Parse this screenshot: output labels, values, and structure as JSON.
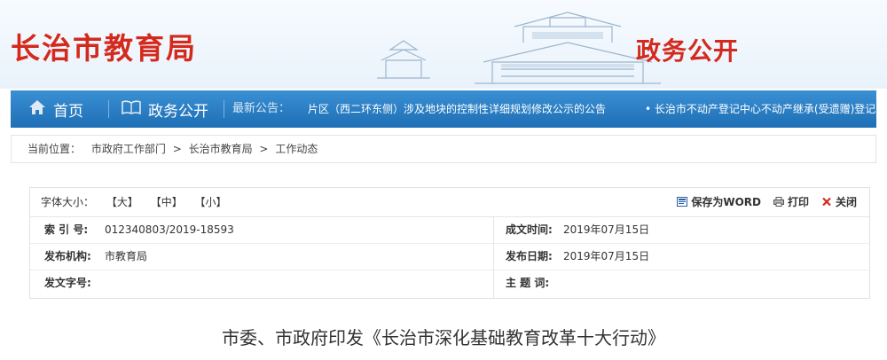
{
  "banner": {
    "title": "长治市教育局",
    "subtitle": "政务公开"
  },
  "nav": {
    "home": "首页",
    "gov": "政务公开",
    "ticker_label": "最新公告：",
    "ticker_1": "片区（西二环东侧）涉及地块的控制性详细规划修改公示的公告",
    "ticker_2": "• 长治市不动产登记中心不动产继承(受遗赠)登记"
  },
  "breadcrumb": {
    "label": "当前位置：",
    "item_1": "市政府工作部门",
    "sep": ">",
    "item_2": "长治市教育局",
    "item_3": "工作动态"
  },
  "tools": {
    "font_size_label": "字体大小：",
    "large": "【大】",
    "medium": "【中】",
    "small": "【小】",
    "save_word": "保存为WORD",
    "print": "打印",
    "close": "关闭"
  },
  "meta": {
    "index_label": "索 引 号:",
    "index_value": "012340803/2019-18593",
    "created_label": "成文时间:",
    "created_value": "2019年07月15日",
    "org_label": "发布机构:",
    "org_value": "市教育局",
    "published_label": "发布日期:",
    "published_value": "2019年07月15日",
    "docno_label": "发文字号:",
    "docno_value": "",
    "topic_label": "主 题 词:",
    "topic_value": ""
  },
  "article": {
    "title": "市委、市政府印发《长治市深化基础教育改革十大行动》"
  },
  "colors": {
    "brand_red": "#d42a1e",
    "nav_blue": "#1e6fb5"
  }
}
